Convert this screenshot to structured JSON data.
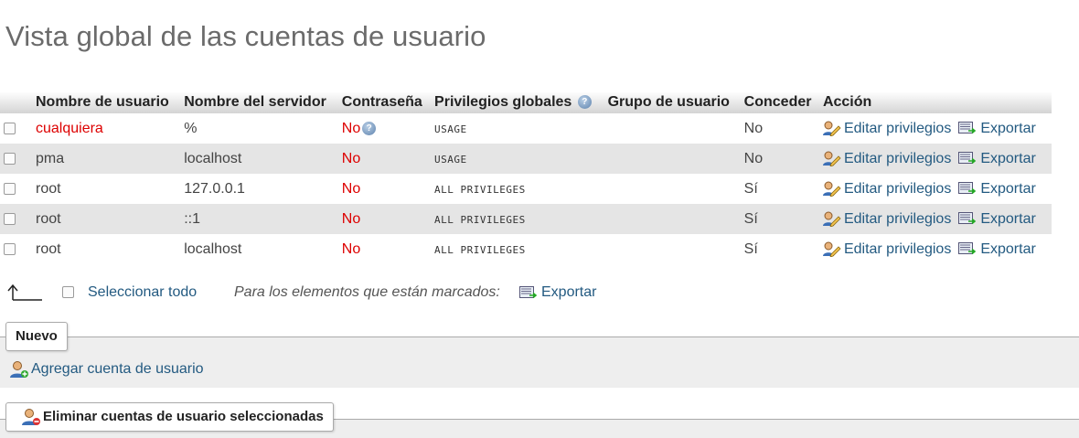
{
  "page": {
    "title": "Vista global de las cuentas de usuario"
  },
  "table": {
    "headers": [
      "Nombre de usuario",
      "Nombre del servidor",
      "Contraseña",
      "Privilegios globales",
      "Grupo de usuario",
      "Conceder",
      "Acción"
    ],
    "rows": [
      {
        "user": "cualquiera",
        "host": "%",
        "password": "No",
        "privileges": "USAGE",
        "group": "",
        "grant": "No",
        "edit": "Editar privilegios",
        "export": "Exportar"
      },
      {
        "user": "pma",
        "host": "localhost",
        "password": "No",
        "privileges": "USAGE",
        "group": "",
        "grant": "No",
        "edit": "Editar privilegios",
        "export": "Exportar"
      },
      {
        "user": "root",
        "host": "127.0.0.1",
        "password": "No",
        "privileges": "ALL PRIVILEGES",
        "group": "",
        "grant": "Sí",
        "edit": "Editar privilegios",
        "export": "Exportar"
      },
      {
        "user": "root",
        "host": "::1",
        "password": "No",
        "privileges": "ALL PRIVILEGES",
        "group": "",
        "grant": "Sí",
        "edit": "Editar privilegios",
        "export": "Exportar"
      },
      {
        "user": "root",
        "host": "localhost",
        "password": "No",
        "privileges": "ALL PRIVILEGES",
        "group": "",
        "grant": "Sí",
        "edit": "Editar privilegios",
        "export": "Exportar"
      }
    ]
  },
  "bulk": {
    "select_all": "Seleccionar todo",
    "for_marked": "Para los elementos que están marcados:",
    "export": "Exportar"
  },
  "new_section": {
    "legend": "Nuevo",
    "add_user": "Agregar cuenta de usuario"
  },
  "delete_section": {
    "legend": "Eliminar cuentas de usuario seleccionadas"
  },
  "colors": {
    "link": "#235a81",
    "no_password": "#dd0000",
    "title": "#6b6b6b"
  }
}
